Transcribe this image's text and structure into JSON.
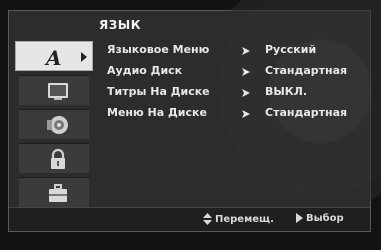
{
  "menu": {
    "title": "ЯЗЫК",
    "rows": [
      {
        "label": "Языковое Меню",
        "value": "Русский"
      },
      {
        "label": "Аудио Диск",
        "value": "Стандартная"
      },
      {
        "label": "Титры На Диске",
        "value": "ВЫКЛ."
      },
      {
        "label": "Меню На Диске",
        "value": "Стандартная"
      }
    ]
  },
  "sidebar": {
    "items": [
      {
        "icon": "language-icon",
        "active": true
      },
      {
        "icon": "display-icon",
        "active": false
      },
      {
        "icon": "audio-speaker-icon",
        "active": false
      },
      {
        "icon": "lock-icon",
        "active": false
      },
      {
        "icon": "others-toolbox-icon",
        "active": false
      }
    ]
  },
  "footer": {
    "move_label": "Перемещ.",
    "select_label": "Выбор"
  },
  "colors": {
    "panel_bg": "#2c2c2c",
    "active_tab": "#e6e6e6",
    "text": "#e8e8e8"
  }
}
